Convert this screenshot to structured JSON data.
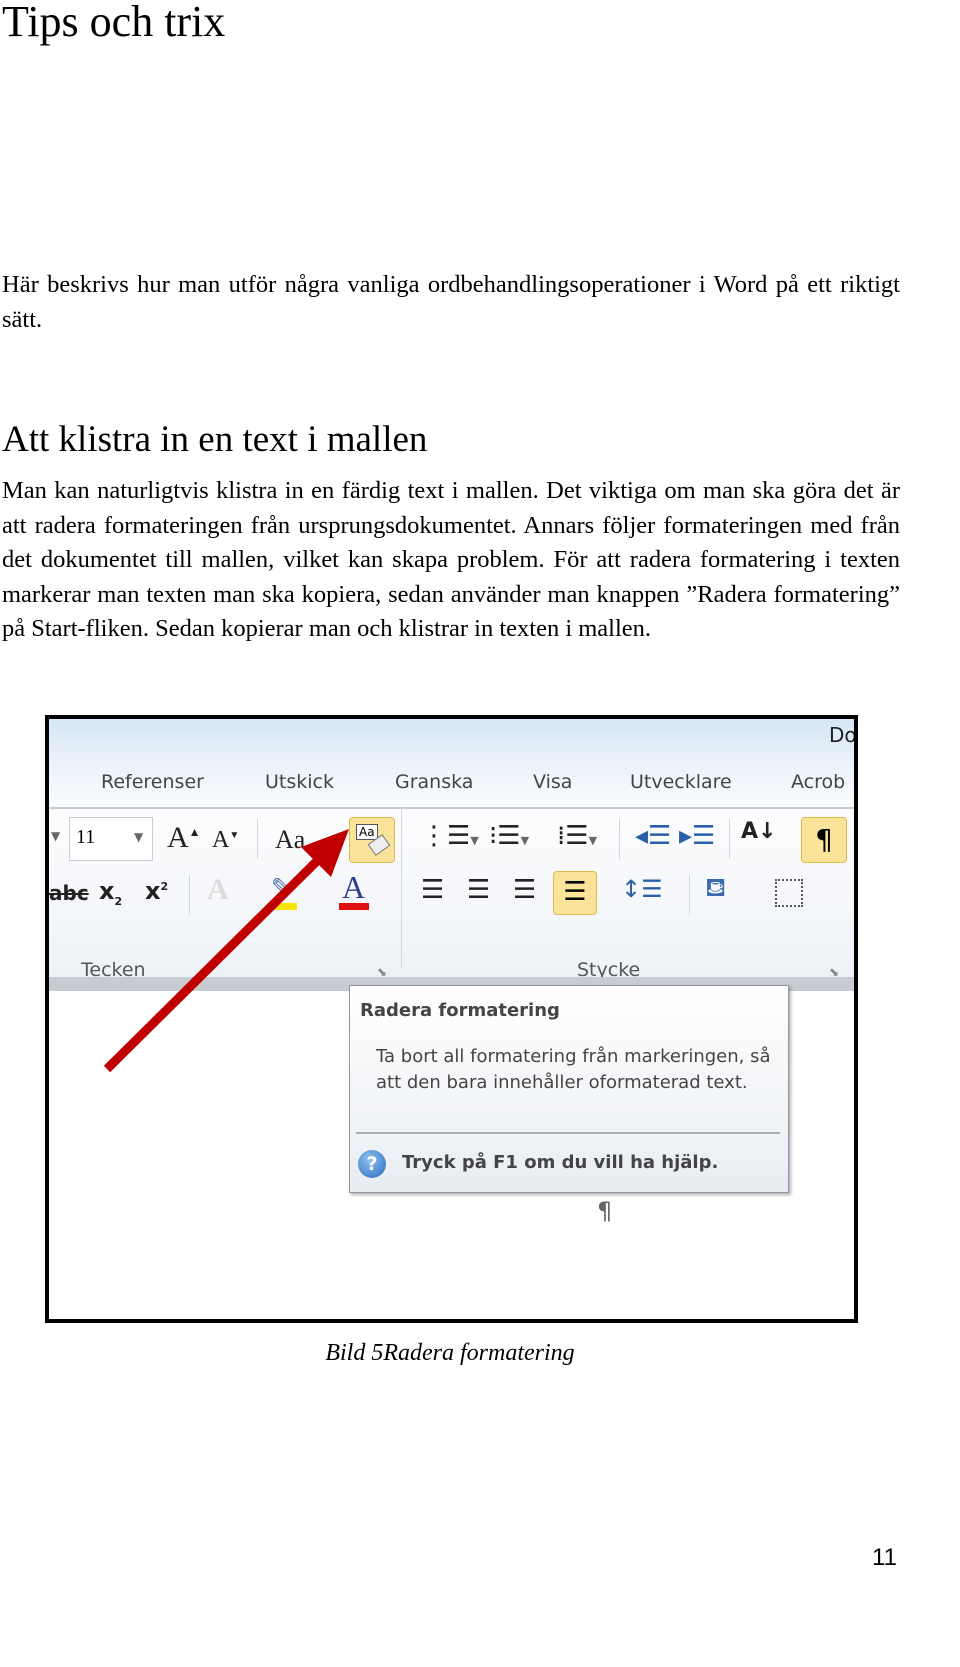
{
  "title": "Tips och trix",
  "intro": "Här beskrivs hur man utför några vanliga ordbehandlingsoperationer i Word på ett riktigt sätt.",
  "section": {
    "heading": "Att klistra in en text i mallen",
    "body": "Man kan naturligtvis klistra in en färdig text i mallen. Det viktiga om man ska göra det är att radera formateringen från ursprungsdokumentet. Annars följer formateringen med från det dokumentet till mallen, vilket kan skapa problem. För att radera formatering i texten markerar man texten man ska kopiera, sedan använder man knappen ”Radera formatering” på Start-fliken. Sedan kopierar man och klistrar in texten i mallen."
  },
  "screenshot": {
    "window_title_fragment": "Do",
    "tabs": [
      "Referenser",
      "Utskick",
      "Granska",
      "Visa",
      "Utvecklare",
      "Acrob"
    ],
    "font_size": "11",
    "groups": [
      "Tecken",
      "Stycke"
    ],
    "tooltip": {
      "title": "Radera formatering",
      "description": "Ta bort all formatering från markeringen, så att den bara innehåller oformaterad text.",
      "help": "Tryck på F1 om du vill ha hjälp."
    },
    "pilcrow": "¶",
    "arrow_color": "#c00000"
  },
  "caption": "Bild 5Radera formatering",
  "page_number": "11"
}
